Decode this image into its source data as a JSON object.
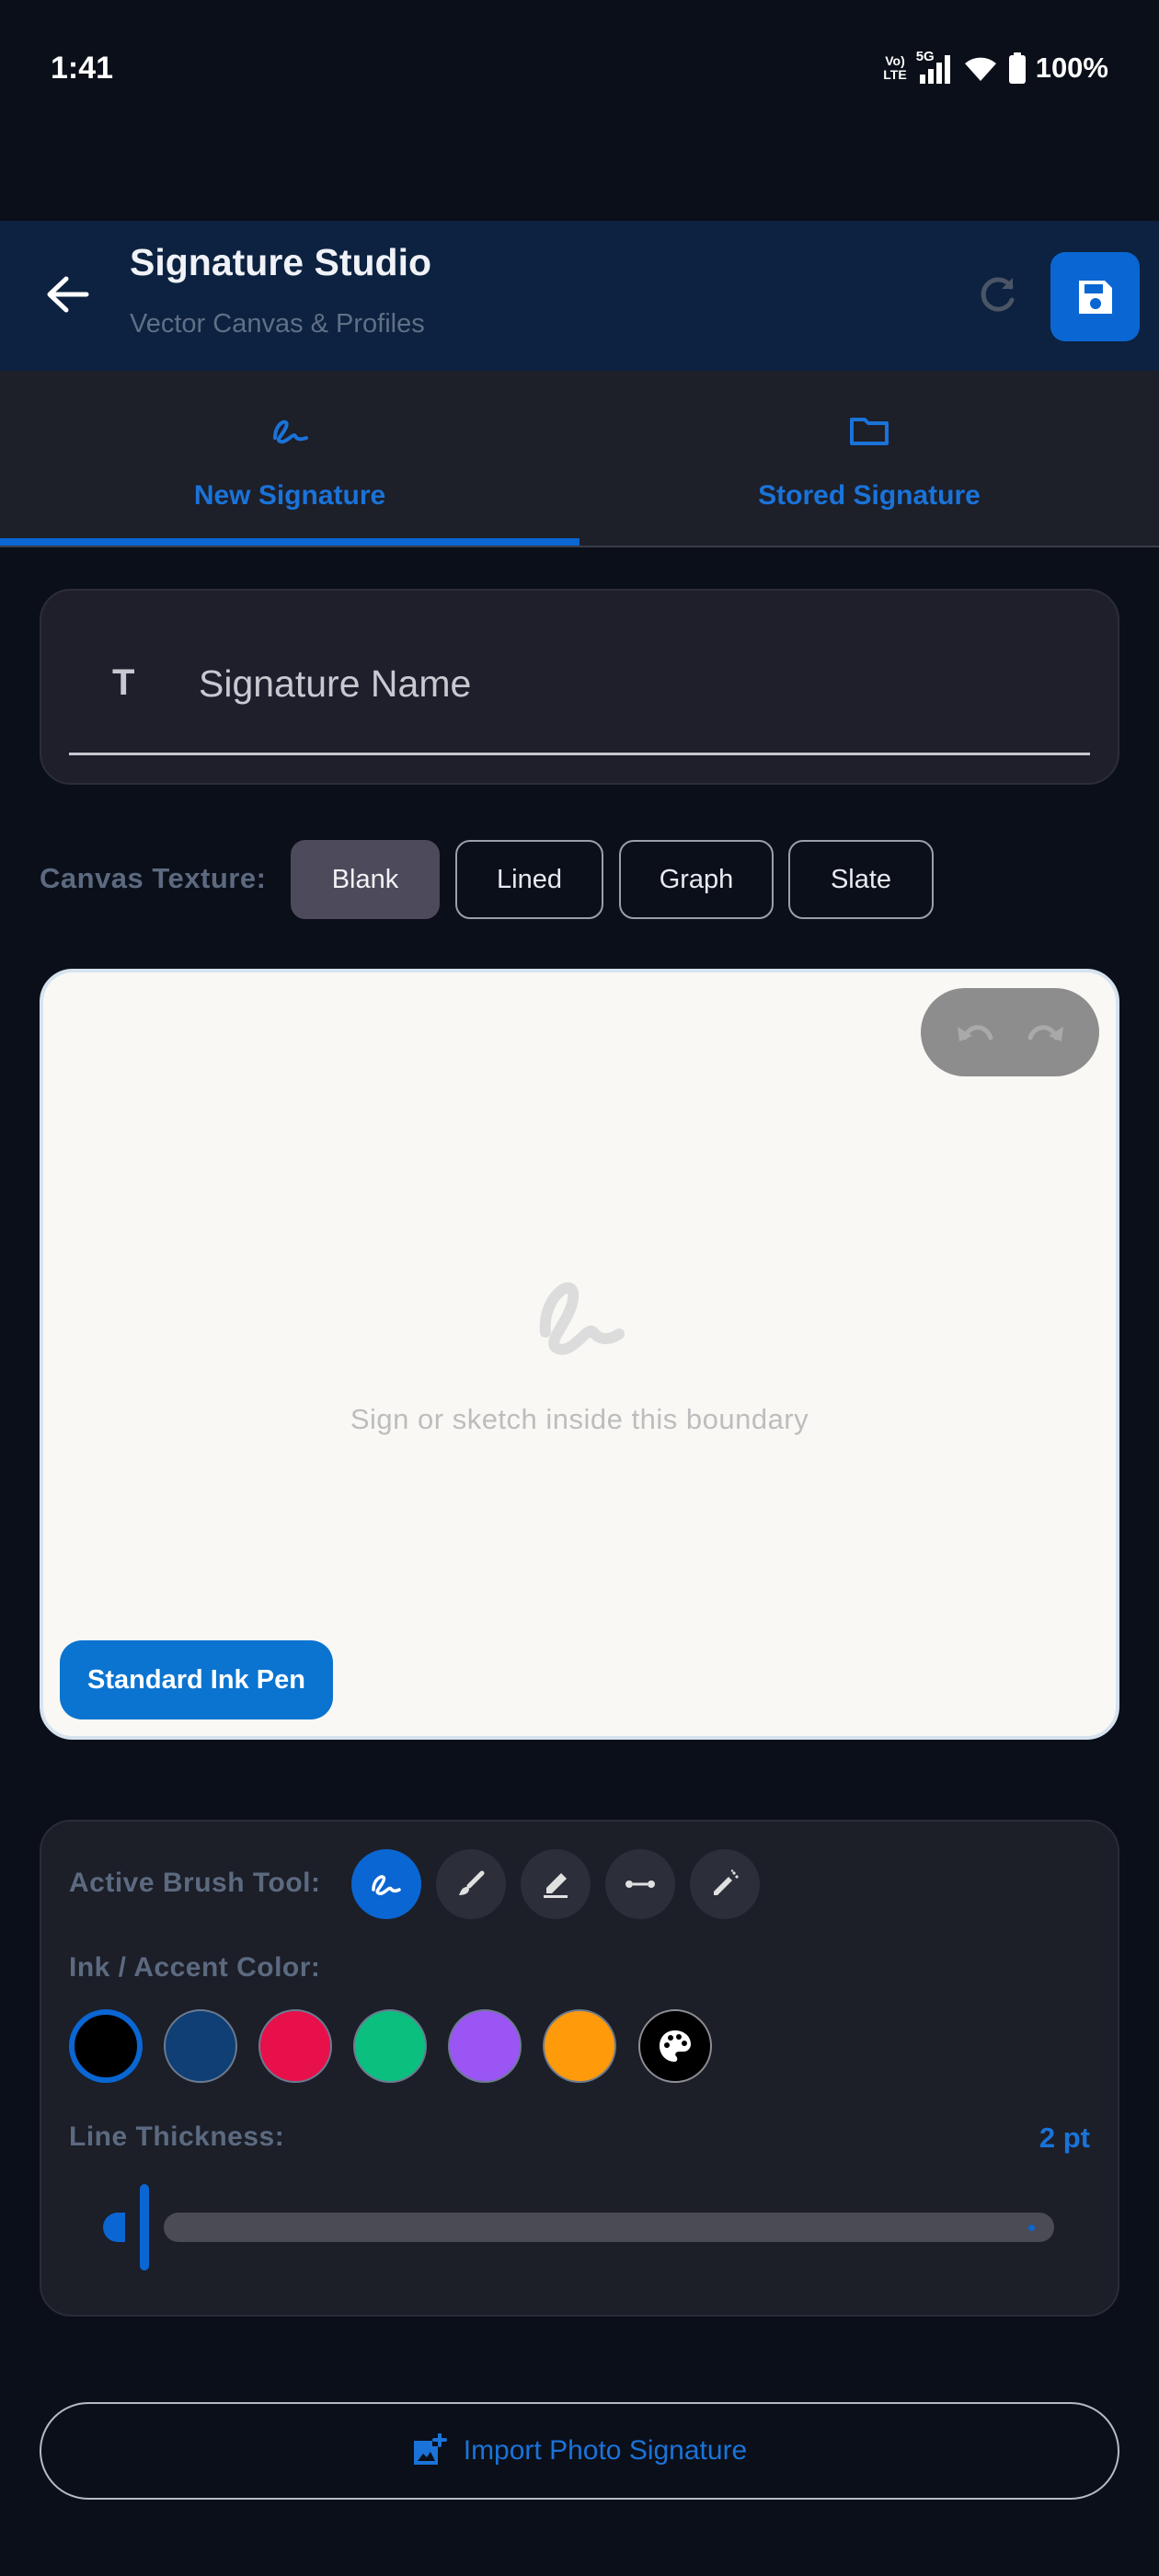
{
  "status_bar": {
    "time": "1:41",
    "network": "5G",
    "volte_top": "Vo)",
    "volte_bottom": "LTE",
    "battery": "100%"
  },
  "app_bar": {
    "title": "Signature Studio",
    "subtitle": "Vector Canvas & Profiles"
  },
  "tabs": [
    {
      "label": "New Signature",
      "icon": "signature-icon",
      "active": true
    },
    {
      "label": "Stored Signature",
      "icon": "folder-icon",
      "active": false
    }
  ],
  "name_field": {
    "placeholder": "Signature Name",
    "icon_glyph": "T"
  },
  "texture": {
    "label": "Canvas Texture:",
    "options": [
      "Blank",
      "Lined",
      "Graph",
      "Slate"
    ],
    "selected": "Blank"
  },
  "canvas": {
    "hint": "Sign or sketch inside this boundary",
    "pen_label": "Standard Ink Pen"
  },
  "tools": {
    "brush_label": "Active Brush Tool:",
    "brushes": [
      "signature-pen-icon",
      "brush-icon",
      "marker-icon",
      "dotted-line-icon",
      "airbrush-icon"
    ],
    "color_label": "Ink / Accent Color:",
    "colors": [
      "#000000",
      "#0f3f75",
      "#e8104a",
      "#0bbf7f",
      "#9b55f5",
      "#ff9a0a"
    ],
    "selected_color": "#000000",
    "thickness_label": "Line Thickness:",
    "thickness_value": "2 pt",
    "thickness": 2
  },
  "import": {
    "label": "Import Photo Signature"
  },
  "accent_color": "#0a66d2"
}
